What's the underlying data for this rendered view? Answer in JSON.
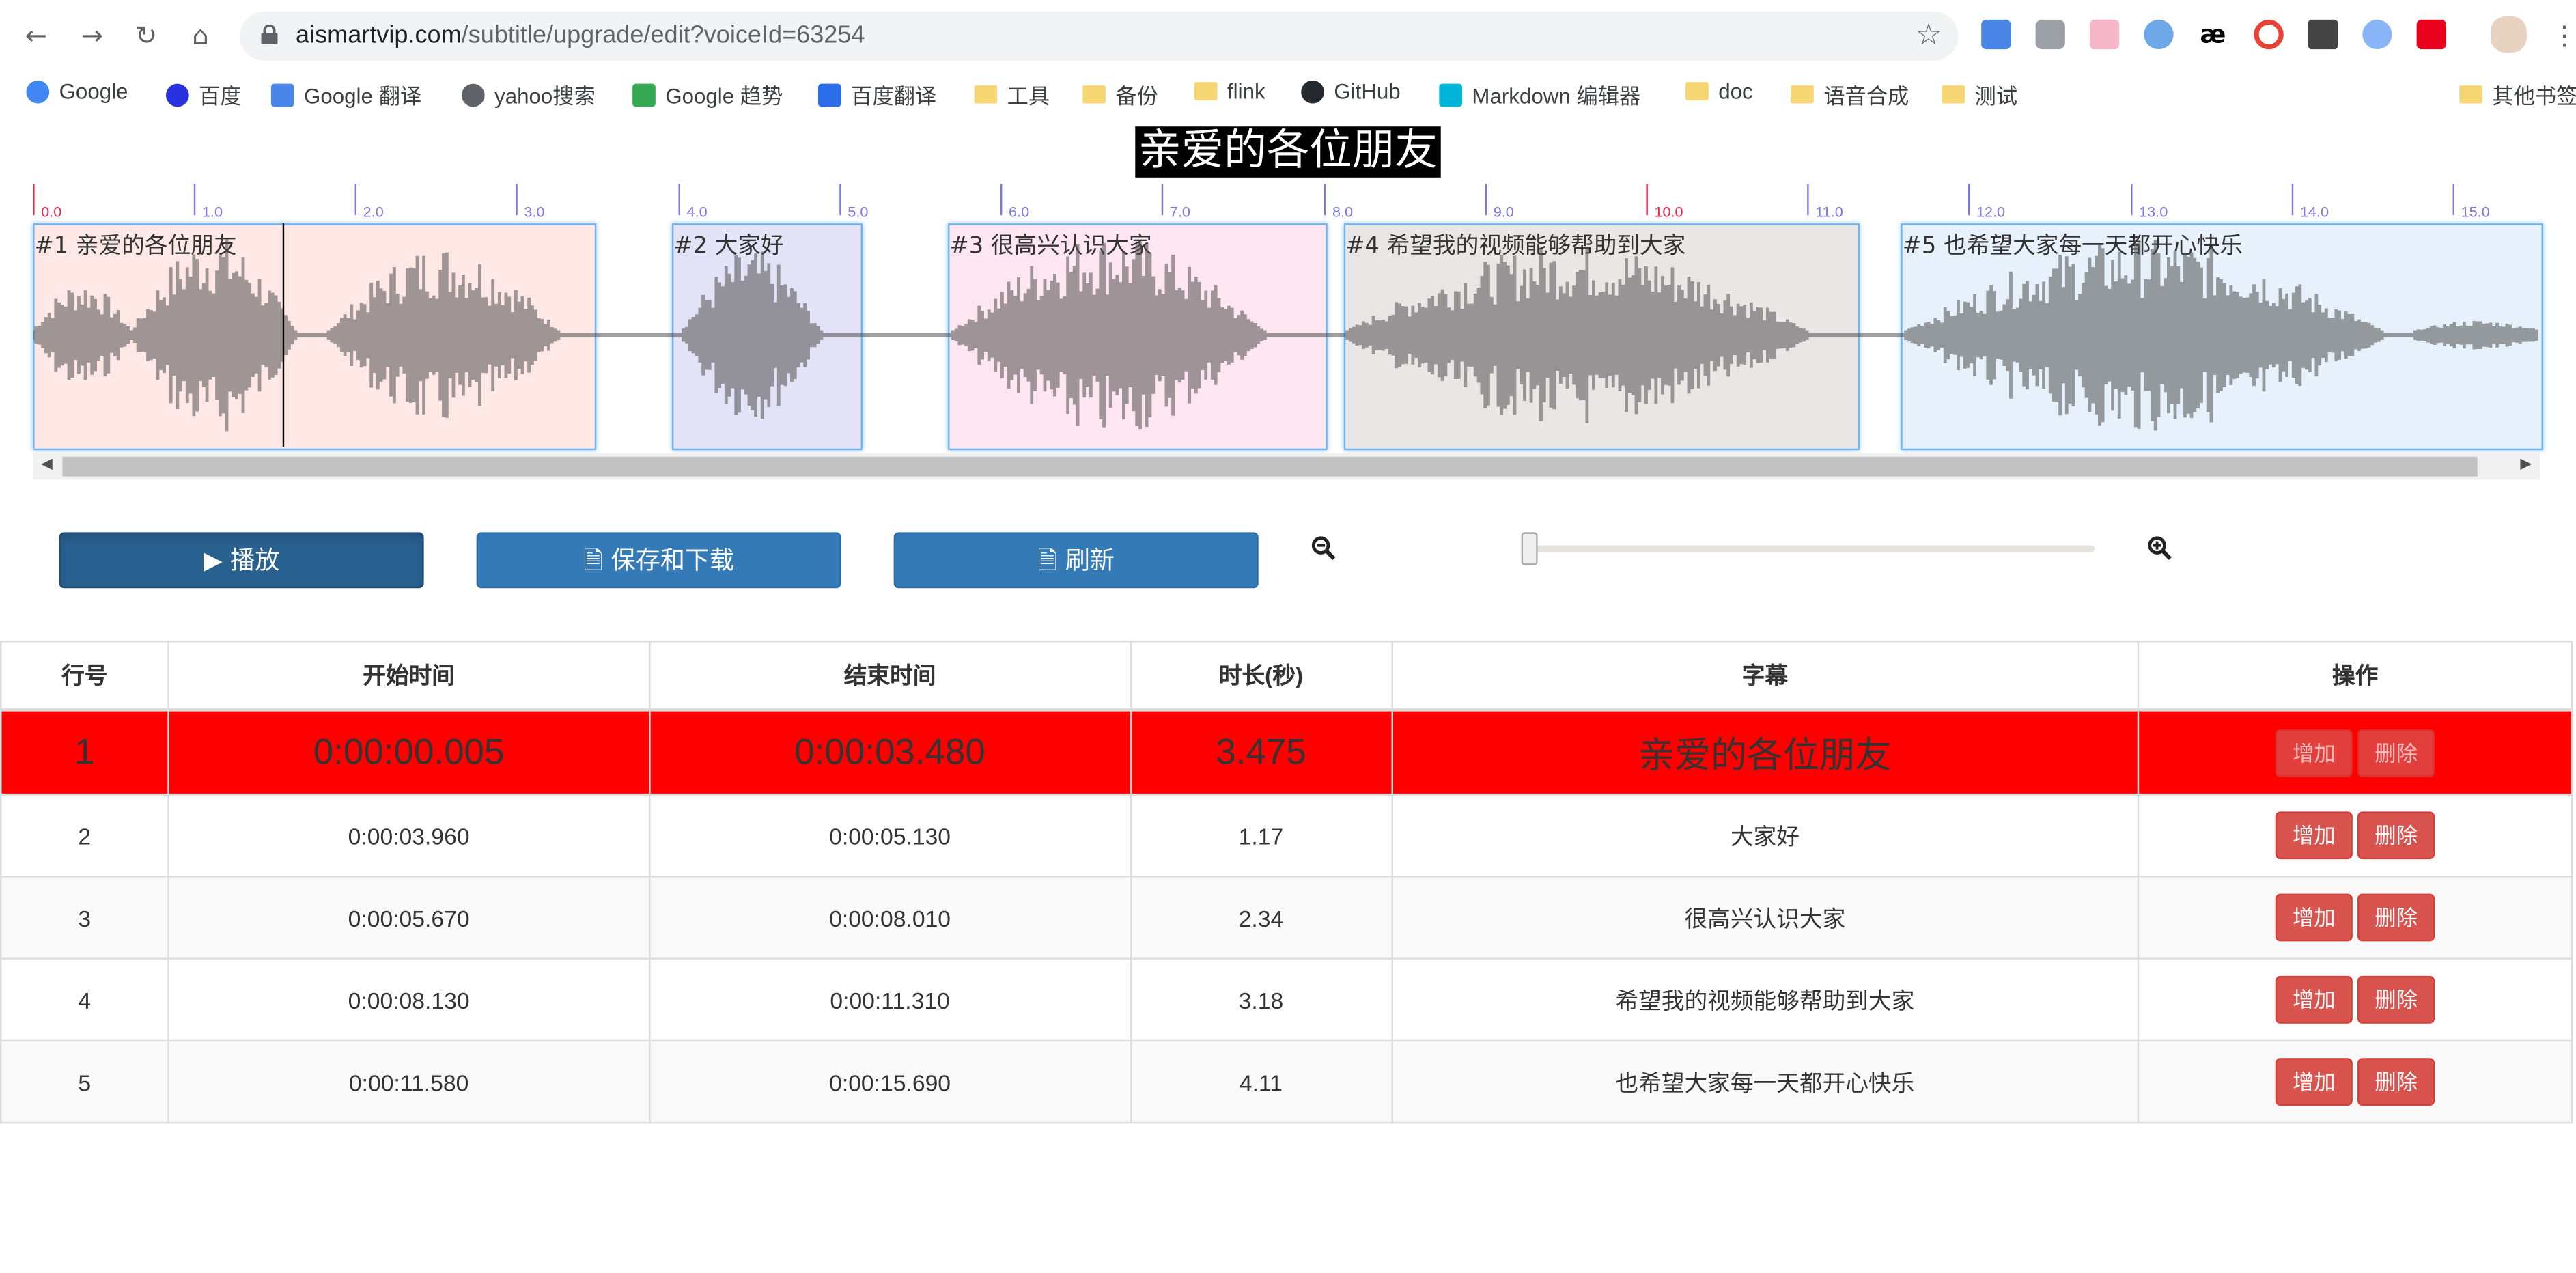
{
  "browser": {
    "url_host": "aismartvip.com",
    "url_path": "/subtitle/upgrade/edit?voiceId=63254",
    "bookmarks": [
      "Google",
      "百度",
      "Google 翻译",
      "yahoo搜索",
      "Google 趋势",
      "百度翻译",
      "工具",
      "备份",
      "flink",
      "GitHub",
      "Markdown 编辑器",
      "doc",
      "语音合成",
      "测试"
    ],
    "other_bookmarks": "其他书签"
  },
  "editor": {
    "current_subtitle": "亲爱的各位朋友",
    "timeline_ticks": [
      "0.0",
      "1.0",
      "2.0",
      "3.0",
      "4.0",
      "5.0",
      "6.0",
      "7.0",
      "8.0",
      "9.0",
      "10.0",
      "11.0",
      "12.0",
      "13.0",
      "14.0",
      "15.0"
    ],
    "regions": [
      {
        "label": "#1 亲爱的各位朋友",
        "color": "#fde8e6"
      },
      {
        "label": "#2 大家好",
        "color": "#e4e2f7"
      },
      {
        "label": "#3 很高兴认识大家",
        "color": "#fde6ef"
      },
      {
        "label": "#4 希望我的视频能够帮助到大家",
        "color": "#ebe6e6"
      },
      {
        "label": "#5 也希望大家每一天都开心快乐",
        "color": "#e6f1fb"
      }
    ]
  },
  "controls": {
    "play_label": "播放",
    "save_label": "保存和下载",
    "refresh_label": "刷新",
    "zoom_level": 0.0
  },
  "table": {
    "headers": [
      "行号",
      "开始时间",
      "结束时间",
      "时长(秒)",
      "字幕",
      "操作"
    ],
    "add_label": "增加",
    "delete_label": "删除",
    "rows": [
      {
        "index": "1",
        "start": "0:00:00.005",
        "end": "0:00:03.480",
        "duration": "3.475",
        "text": "亲爱的各位朋友"
      },
      {
        "index": "2",
        "start": "0:00:03.960",
        "end": "0:00:05.130",
        "duration": "1.17",
        "text": "大家好"
      },
      {
        "index": "3",
        "start": "0:00:05.670",
        "end": "0:00:08.010",
        "duration": "2.34",
        "text": "很高兴认识大家"
      },
      {
        "index": "4",
        "start": "0:00:08.130",
        "end": "0:00:11.310",
        "duration": "3.18",
        "text": "希望我的视频能够帮助到大家"
      },
      {
        "index": "5",
        "start": "0:00:11.580",
        "end": "0:00:15.690",
        "duration": "4.11",
        "text": "也希望大家每一天都开心快乐"
      }
    ]
  }
}
